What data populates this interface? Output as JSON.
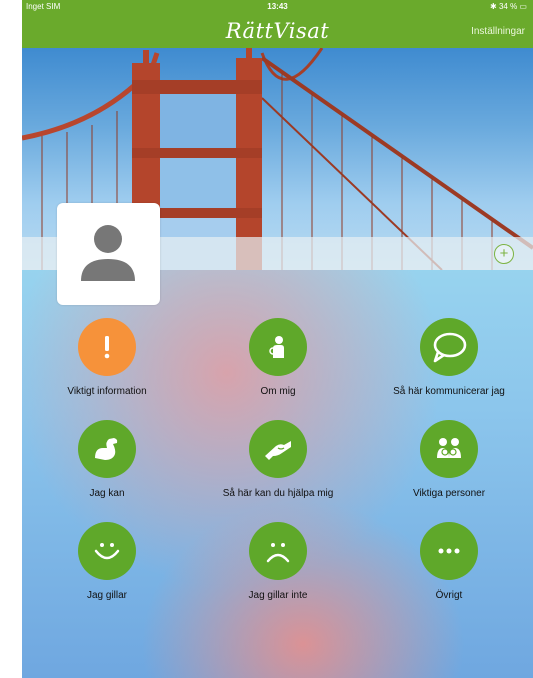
{
  "status_bar": {
    "carrier": "Inget SIM",
    "time": "13:43",
    "battery": "✱ 34 % ▭"
  },
  "nav": {
    "title": "RättVisat",
    "settings_label": "Inställningar"
  },
  "cover": {
    "add_label": "+"
  },
  "colors": {
    "brand_green": "#6aaa2c",
    "tile_green": "#5fa82a",
    "alert_orange": "#f6923a"
  },
  "tiles": [
    {
      "label": "Viktigt information",
      "icon": "exclamation-icon",
      "color": "#f6923a"
    },
    {
      "label": "Om mig",
      "icon": "person-icon",
      "color": "#5fa82a"
    },
    {
      "label": "Så här kommunicerar jag",
      "icon": "speech-bubble-icon",
      "color": "#5fa82a"
    },
    {
      "label": "Jag kan",
      "icon": "flexed-arm-icon",
      "color": "#5fa82a"
    },
    {
      "label": "Så här kan du hjälpa mig",
      "icon": "helping-hands-icon",
      "color": "#5fa82a"
    },
    {
      "label": "Viktiga personer",
      "icon": "people-icon",
      "color": "#5fa82a"
    },
    {
      "label": "Jag gillar",
      "icon": "smiley-icon",
      "color": "#5fa82a"
    },
    {
      "label": "Jag gillar inte",
      "icon": "frown-icon",
      "color": "#5fa82a"
    },
    {
      "label": "Övrigt",
      "icon": "more-dots-icon",
      "color": "#5fa82a"
    }
  ]
}
